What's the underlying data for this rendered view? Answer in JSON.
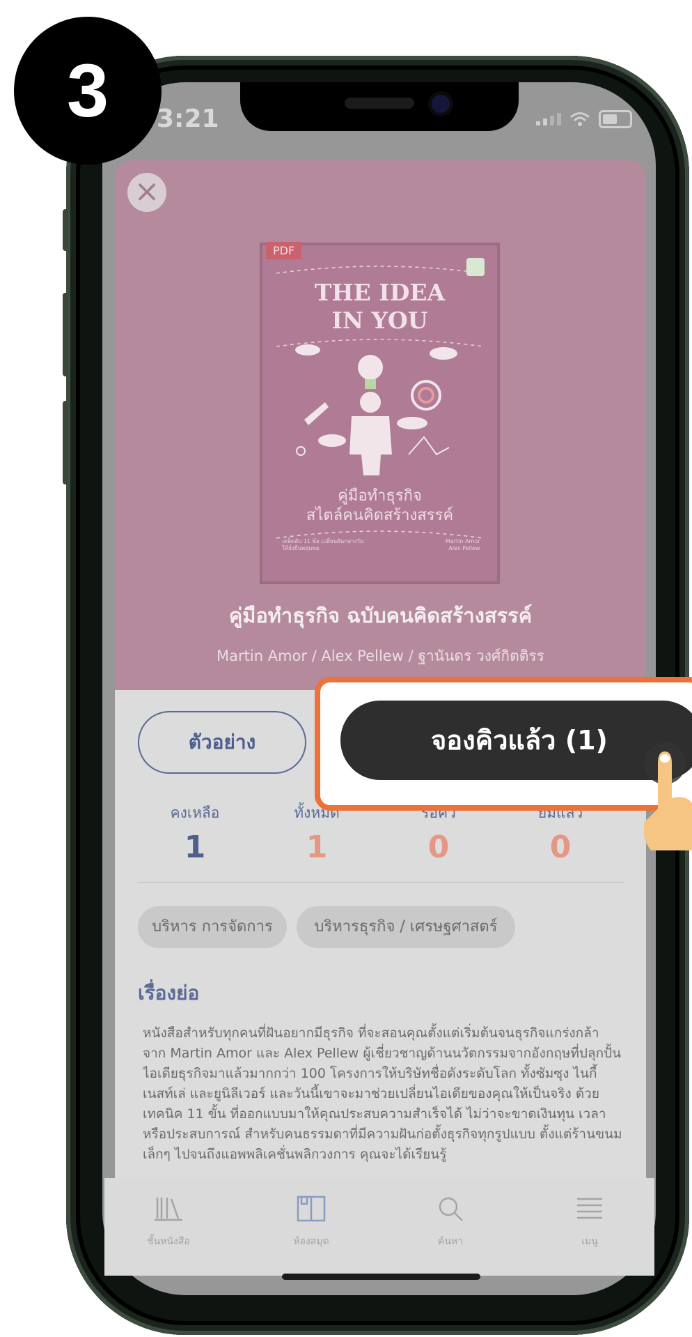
{
  "step_badge": "3",
  "status_bar": {
    "time": "3:21"
  },
  "book": {
    "format_tag": "PDF",
    "cover_title_line1": "THE IDEA",
    "cover_title_line2": "IN YOU",
    "cover_subtitle_line1": "คู่มือทำธุรกิจ",
    "cover_subtitle_line2": "สไตล์คนคิดสร้างสรรค์",
    "cover_small_left_line1": "เคล็ดลับ 11 ข้อ เปลี่ยนฝันกลางวัน",
    "cover_small_left_line2": "ให้ยั่งยืนพลุ่มพอ",
    "cover_small_right_line1": "Martin Amor",
    "cover_small_right_line2": "Alex Pellew",
    "title": "คู่มือทำธุรกิจ ฉบับคนคิดสร้างสรรค์",
    "authors": "Martin Amor / Alex Pellew / ฐานันดร วงศ์กิตติรร"
  },
  "actions": {
    "sample_label": "ตัวอย่าง",
    "reserved_label": "จองคิวแล้ว (1)"
  },
  "stats": [
    {
      "label": "คงเหลือ",
      "value": "1",
      "color": "#4f5e8d"
    },
    {
      "label": "ทั้งหมด",
      "value": "1",
      "color": "#e39784"
    },
    {
      "label": "รอคิว",
      "value": "0",
      "color": "#e39784"
    },
    {
      "label": "ยืมแล้ว",
      "value": "0",
      "color": "#e39784"
    }
  ],
  "tags": [
    "บริหาร การจัดการ",
    "บริหารธุรกิจ / เศรษฐศาสตร์"
  ],
  "synopsis": {
    "heading": "เรื่องย่อ",
    "text": "หนังสือสำหรับทุกคนที่ฝันอยากมีธุรกิจ ที่จะสอนคุณตั้งแต่เริ่มต้นจนธุรกิจแกร่งกล้า จาก Martin Amor และ Alex Pellew ผู้เชี่ยวชาญด้านนวัตกรรมจากอังกฤษที่ปลุกปั้นไอเดียธุรกิจมาแล้วมากกว่า 100 โครงการให้บริษัทชื่อดังระดับโลก ทั้งซัมซุง ไนกี้ เนสท์เล่ และยูนิลีเวอร์ และวันนี้เขาจะมาช่วยเปลี่ยนไอเดียของคุณให้เป็นจริง ด้วยเทคนิค 11 ขั้น ที่ออกแบบมาให้คุณประสบความสำเร็จได้ ไม่ว่าจะขาดเงินทุน เวลา หรือประสบการณ์ สำหรับคนธรรมดาที่มีความฝันก่อตั้งธุรกิจทุกรูปแบบ ตั้งแต่ร้านขนมเล็กๆ ไปจนถึงแอพพลิเคชั่นพลิกวงการ คุณจะได้เรียนรู้"
  },
  "tabs": [
    {
      "label": "ชั้นหนังสือ",
      "icon": "bookshelf-icon"
    },
    {
      "label": "ห้องสมุด",
      "icon": "library-book-icon"
    },
    {
      "label": "ค้นหา",
      "icon": "search-icon"
    },
    {
      "label": "เมนู",
      "icon": "menu-icon"
    }
  ],
  "colors": {
    "header_bg": "#b58a9c",
    "accent_orange": "#ec7239",
    "primary_dark": "#2e2e2e",
    "accent_blue": "#5a6a97"
  }
}
